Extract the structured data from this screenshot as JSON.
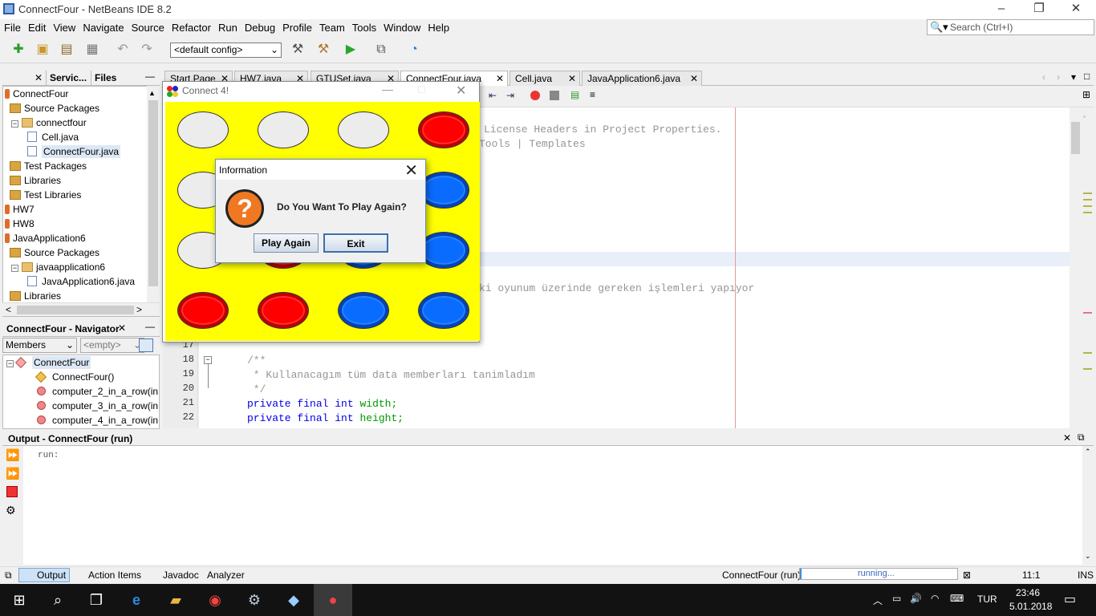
{
  "window": {
    "title": "ConnectFour - NetBeans IDE 8.2"
  },
  "menu": [
    "File",
    "Edit",
    "View",
    "Navigate",
    "Source",
    "Refactor",
    "Run",
    "Debug",
    "Profile",
    "Team",
    "Tools",
    "Window",
    "Help"
  ],
  "search": {
    "placeholder": "Search (Ctrl+I)"
  },
  "toolbar": {
    "config": "<default config>"
  },
  "project_panel": {
    "tabs": [
      "Servic...",
      "Files"
    ],
    "tree": [
      {
        "label": "ConnectFour",
        "indent": 0,
        "icon": "cup"
      },
      {
        "label": "Source Packages",
        "indent": 1,
        "icon": "folder"
      },
      {
        "label": "connectfour",
        "indent": 2,
        "icon": "package"
      },
      {
        "label": "Cell.java",
        "indent": 3,
        "icon": "java"
      },
      {
        "label": "ConnectFour.java",
        "indent": 3,
        "icon": "java"
      },
      {
        "label": "Test Packages",
        "indent": 1,
        "icon": "folder"
      },
      {
        "label": "Libraries",
        "indent": 1,
        "icon": "folder"
      },
      {
        "label": "Test Libraries",
        "indent": 1,
        "icon": "folder"
      },
      {
        "label": "HW7",
        "indent": 0,
        "icon": "cup"
      },
      {
        "label": "HW8",
        "indent": 0,
        "icon": "cup"
      },
      {
        "label": "JavaApplication6",
        "indent": 0,
        "icon": "cup"
      },
      {
        "label": "Source Packages",
        "indent": 1,
        "icon": "folder"
      },
      {
        "label": "javaapplication6",
        "indent": 2,
        "icon": "package"
      },
      {
        "label": "JavaApplication6.java",
        "indent": 3,
        "icon": "java"
      },
      {
        "label": "Libraries",
        "indent": 1,
        "icon": "folder"
      }
    ]
  },
  "navigator": {
    "title": "ConnectFour - Navigator",
    "filter": "Members",
    "empty": "<empty>",
    "items": [
      {
        "label": "ConnectFour",
        "kind": "class"
      },
      {
        "label": "ConnectFour()",
        "kind": "ctor"
      },
      {
        "label": "computer_2_in_a_row(in",
        "kind": "method"
      },
      {
        "label": "computer_3_in_a_row(in",
        "kind": "method"
      },
      {
        "label": "computer_4_in_a_row(in",
        "kind": "method"
      }
    ]
  },
  "editor": {
    "tabs": [
      "Start Page",
      "HW7.java",
      "GTUSet.java",
      "ConnectFour.java",
      "Cell.java",
      "JavaApplication6.java"
    ],
    "line_numbers": [
      "17",
      "18",
      "19",
      "20",
      "21",
      "22"
    ],
    "partial_lines": [
      "License Headers in Project Properties.",
      "Tools | Templates",
      "ki oyunum üzerinde gereken işlemleri yapıyor"
    ],
    "code": [
      "/**",
      " * Kullanacagım tüm data memberları tanimladım",
      " */"
    ],
    "decl1": {
      "kw1": "private",
      "kw2": "final",
      "kw3": "int",
      "name": "width;"
    },
    "decl2": {
      "kw1": "private",
      "kw2": "final",
      "kw3": "int",
      "name": "height;"
    }
  },
  "game": {
    "title": "Connect 4!",
    "board": [
      [
        "empty",
        "empty",
        "empty",
        "red"
      ],
      [
        "empty",
        "empty",
        "empty",
        "blue"
      ],
      [
        "empty",
        "red",
        "blue",
        "blue"
      ],
      [
        "red",
        "red",
        "blue",
        "blue"
      ]
    ],
    "colors": {
      "board": "#ffff00",
      "red": "#ff0000",
      "blue": "#0a6cff"
    }
  },
  "dialog": {
    "title": "Information",
    "message": "Do You Want To Play Again?",
    "icon": "question-icon",
    "buttons": {
      "play_again": "Play Again",
      "exit": "Exit"
    }
  },
  "output": {
    "title": "Output - ConnectFour (run)",
    "text": "run:"
  },
  "statusbar": {
    "tabs": [
      "Output",
      "Action Items",
      "Javadoc",
      "Analyzer"
    ],
    "process": "ConnectFour (run)",
    "progress_text": "running...",
    "position": "11:1",
    "mode": "INS"
  },
  "taskbar": {
    "lang": "TUR",
    "time": "23:46",
    "date": "5.01.2018"
  }
}
